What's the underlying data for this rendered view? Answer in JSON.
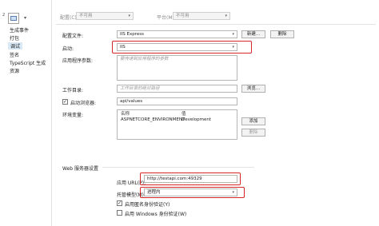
{
  "colors": {
    "highlight": "#d62828",
    "sidebar_active": "#d9e8f5"
  },
  "sidebar": {
    "header_number": "2",
    "items": [
      {
        "label": "生成事件"
      },
      {
        "label": "打包"
      },
      {
        "label": "调试"
      },
      {
        "label": "签名"
      },
      {
        "label": "TypeScript 生成"
      },
      {
        "label": "资源"
      }
    ]
  },
  "top_bar": {
    "config_label": "配置(C):",
    "config_value": "不可用",
    "platform_label": "平台(M):",
    "platform_value": "不可用"
  },
  "profile": {
    "label": "配置文件:",
    "value": "IIS Express",
    "new_button": "新建...",
    "delete_button": "删除"
  },
  "launch": {
    "label": "启动:",
    "value": "IIS"
  },
  "app_args": {
    "label": "应用程序参数:",
    "placeholder": "要传递到应用程序的参数"
  },
  "working_dir": {
    "label": "工作目录:",
    "placeholder": "工作目录的绝对路径",
    "browse_button": "浏览..."
  },
  "launch_browser": {
    "label": "启动浏览器:",
    "checked": "✓",
    "value": "api/values"
  },
  "env_vars": {
    "label": "环境变量:",
    "columns": [
      "名称",
      "值"
    ],
    "rows": [
      {
        "name": "ASPNETCORE_ENVIRONMENT",
        "value": "Development"
      }
    ],
    "add_button": "添加",
    "remove_button": "删除"
  },
  "web_server": {
    "section_title": "Web 服务器设置",
    "app_url_label": "应用 URL(P):",
    "app_url_value": "http://testapi.com:49329",
    "hosting_label": "托管模型(M):",
    "hosting_value": "进程内",
    "anon_auth": {
      "label": "启用匿名身份验证(Y)",
      "checked": "✓"
    },
    "win_auth": {
      "label": "启用 Windows 身份验证(W)",
      "checked": ""
    }
  }
}
